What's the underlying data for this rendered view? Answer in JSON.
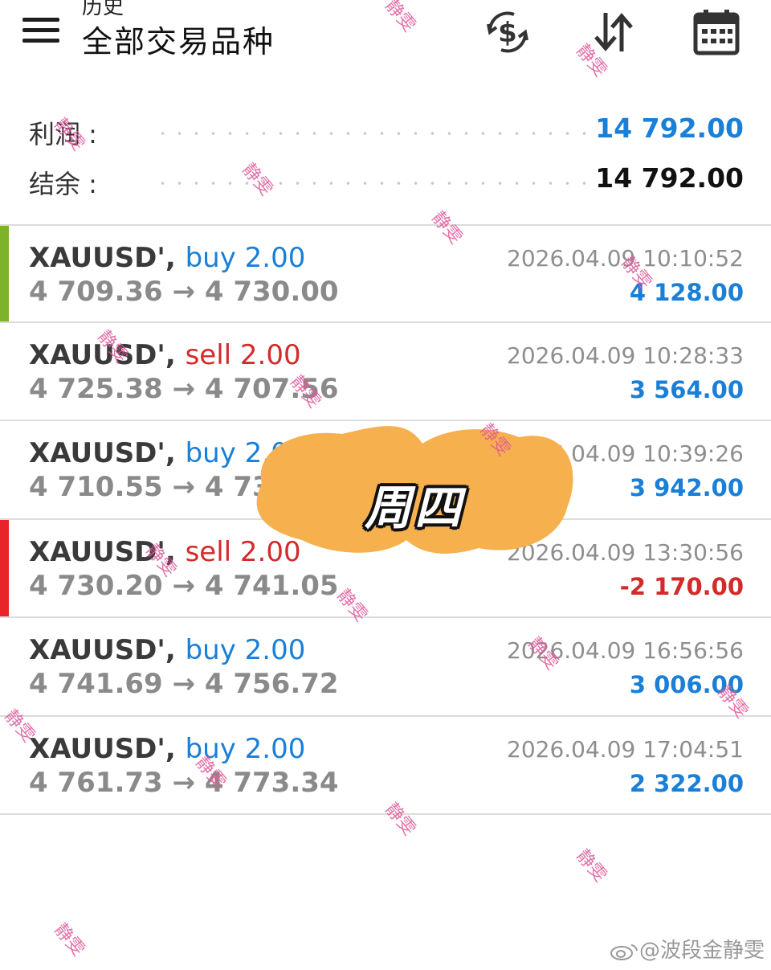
{
  "header": {
    "subtitle": "历史",
    "title": "全部交易品种",
    "icons": [
      "menu-icon",
      "currency-exchange-icon",
      "sort-icon",
      "calendar-icon"
    ]
  },
  "summary": {
    "profit_label": "利润 :",
    "profit_value": "14 792.00",
    "balance_label": "结余 :",
    "balance_value": "14 792.00"
  },
  "colors": {
    "buy": "#1a7fd6",
    "sell": "#d42a2a",
    "positive": "#1a7fd6",
    "negative": "#d42a2a",
    "bar_green": "#7db32a",
    "bar_red": "#e8242a",
    "blob": "#f6b04e"
  },
  "trades": [
    {
      "symbol": "XAUUSD',",
      "side": "buy 2.00",
      "side_type": "buy",
      "prices": "4 709.36 → 4 730.00",
      "time": "2026.04.09 10:10:52",
      "pnl": "4 128.00",
      "pnl_type": "positive",
      "bar": "green"
    },
    {
      "symbol": "XAUUSD',",
      "side": "sell 2.00",
      "side_type": "sell",
      "prices": "4 725.38 → 4 707.56",
      "time": "2026.04.09 10:28:33",
      "pnl": "3 564.00",
      "pnl_type": "positive",
      "bar": "none"
    },
    {
      "symbol": "XAUUSD',",
      "side": "buy 2.00",
      "side_type": "buy",
      "prices": "4 710.55 → 4 730",
      "time": "2026.04.09 10:39:26",
      "pnl": "3 942.00",
      "pnl_type": "positive",
      "bar": "none"
    },
    {
      "symbol": "XAUUSD',",
      "side": "sell 2.00",
      "side_type": "sell",
      "prices": "4 730.20 → 4 741.05",
      "time": "2026.04.09 13:30:56",
      "pnl": "-2 170.00",
      "pnl_type": "negative",
      "bar": "red"
    },
    {
      "symbol": "XAUUSD',",
      "side": "buy 2.00",
      "side_type": "buy",
      "prices": "4 741.69 → 4 756.72",
      "time": "2026.04.09 16:56:56",
      "pnl": "3 006.00",
      "pnl_type": "positive",
      "bar": "none"
    },
    {
      "symbol": "XAUUSD',",
      "side": "buy 2.00",
      "side_type": "buy",
      "prices": "4 761.73 → 4 773.34",
      "time": "2026.04.09 17:04:51",
      "pnl": "2 322.00",
      "pnl_type": "positive",
      "bar": "none"
    }
  ],
  "overlay": {
    "text": "周四"
  },
  "watermark": {
    "text": "静雯"
  },
  "credit": {
    "text": "@波段金静雯"
  }
}
